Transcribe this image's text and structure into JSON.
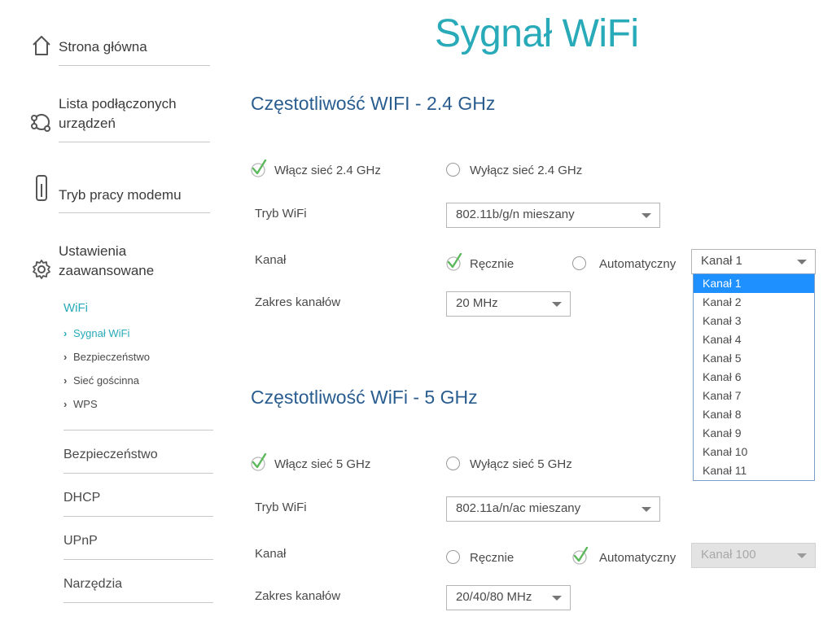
{
  "page": {
    "title": "Sygnał WiFi"
  },
  "sidebar": {
    "items": [
      {
        "label": "Strona główna",
        "icon": "home-icon"
      },
      {
        "label_line1": "Lista podłączonych",
        "label_line2": "urządzeń",
        "icon": "devices-icon"
      },
      {
        "label": "Tryb pracy modemu",
        "icon": "modem-icon"
      },
      {
        "label_line1": "Ustawienia",
        "label_line2": "zaawansowane",
        "icon": "gear-icon"
      }
    ],
    "submenu_heading": "WiFi",
    "submenu": [
      {
        "label": "Sygnał WiFi",
        "active": true
      },
      {
        "label": "Bezpieczeństwo",
        "active": false
      },
      {
        "label": "Sieć gościnna",
        "active": false
      },
      {
        "label": "WPS",
        "active": false
      }
    ],
    "links": [
      "Bezpieczeństwo",
      "DHCP",
      "UPnP",
      "Narzędzia"
    ]
  },
  "band24": {
    "title": "Częstotliwość WIFI - 2.4 GHz",
    "enable_label": "Włącz sieć 2.4 GHz",
    "disable_label": "Wyłącz sieć 2.4 GHz",
    "enabled": true,
    "mode_label": "Tryb WiFi",
    "mode_value": "802.11b/g/n mieszany",
    "channel_label": "Kanał",
    "manual_label": "Ręcznie",
    "auto_label": "Automatyczny",
    "channel_mode": "manual",
    "channel_value": "Kanał 1",
    "channel_options": [
      "Kanał 1",
      "Kanał 2",
      "Kanał 3",
      "Kanał 4",
      "Kanał 5",
      "Kanał 6",
      "Kanał 7",
      "Kanał 8",
      "Kanał 9",
      "Kanał 10",
      "Kanał 11"
    ],
    "channel_dropdown_open": true,
    "range_label": "Zakres kanałów",
    "range_value": "20 MHz"
  },
  "band5": {
    "title": "Częstotliwość WiFi - 5 GHz",
    "enable_label": "Włącz sieć 5 GHz",
    "disable_label": "Wyłącz sieć 5 GHz",
    "enabled": true,
    "mode_label": "Tryb WiFi",
    "mode_value": "802.11a/n/ac mieszany",
    "channel_label": "Kanał",
    "manual_label": "Ręcznie",
    "auto_label": "Automatyczny",
    "channel_mode": "auto",
    "channel_value": "Kanał 100",
    "range_label": "Zakres kanałów",
    "range_value": "20/40/80 MHz"
  },
  "colors": {
    "accent": "#28aab8",
    "section_title": "#2a5d8f",
    "checkmark": "#5cb85c",
    "dropdown_highlight": "#1e90ff"
  }
}
